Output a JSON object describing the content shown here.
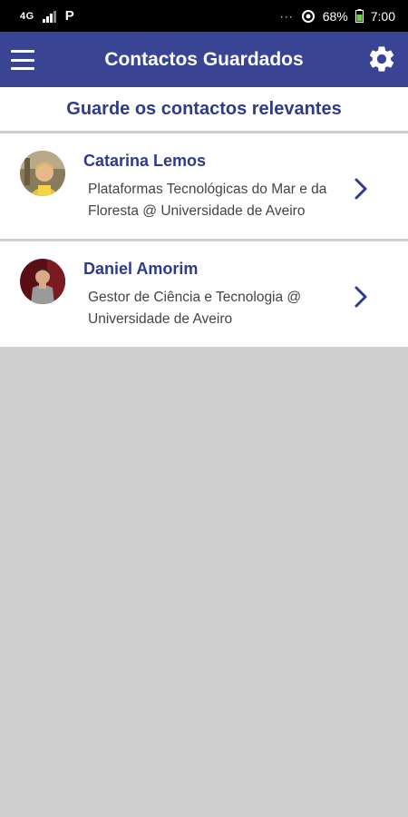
{
  "status_bar": {
    "network": "4G",
    "app_letter": "P",
    "dots": "···",
    "battery": "68%",
    "time": "7:00"
  },
  "app_bar": {
    "title": "Contactos Guardados",
    "menu_icon": "hamburger-menu-icon",
    "settings_icon": "gear-icon"
  },
  "subtitle": "Guarde os contactos relevantes",
  "contacts": [
    {
      "name": "Catarina Lemos",
      "description": "Plataformas Tecnológicas do Mar e da Floresta @ Universidade de Aveiro"
    },
    {
      "name": "Daniel Amorim",
      "description": "Gestor de Ciência e Tecnologia @ Universidade de Aveiro"
    }
  ],
  "colors": {
    "primary": "#3a4495",
    "accent_text": "#2e3a8c",
    "background": "#cfcfcf",
    "card": "#ffffff"
  }
}
